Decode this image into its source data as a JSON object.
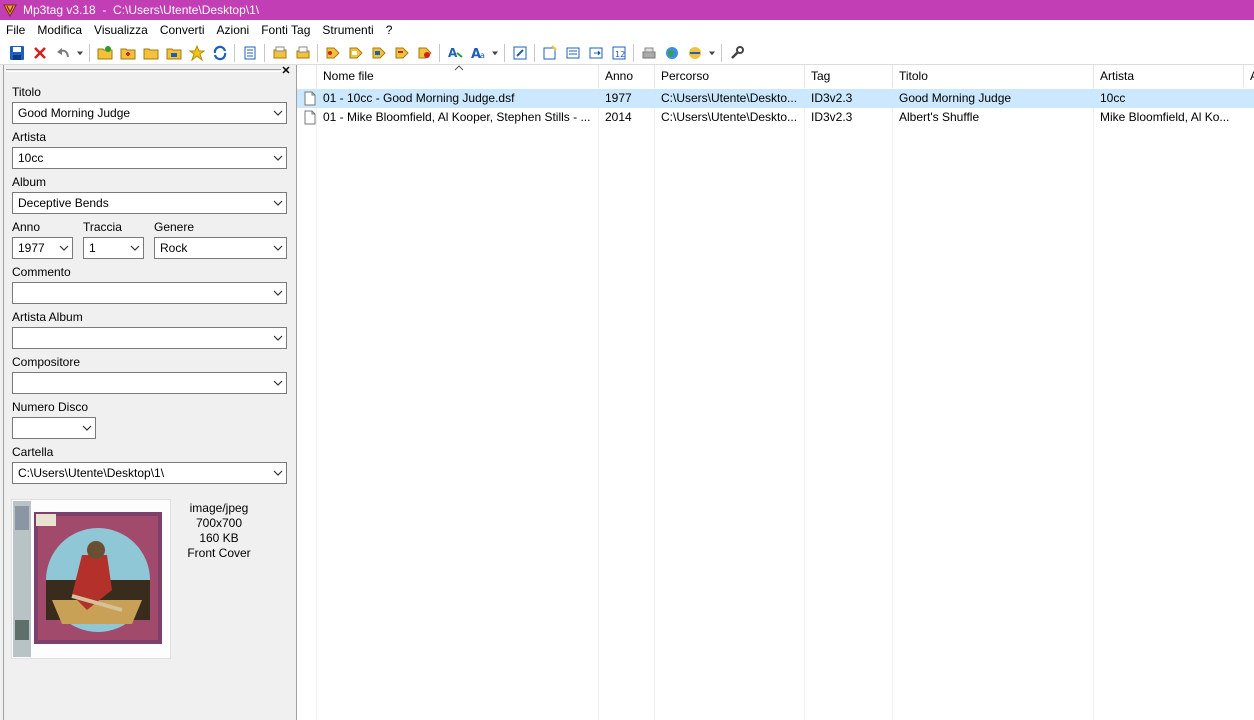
{
  "window": {
    "title": "Mp3tag v3.18  -  C:\\Users\\Utente\\Desktop\\1\\"
  },
  "menu": [
    "File",
    "Modifica",
    "Visualizza",
    "Converti",
    "Azioni",
    "Fonti Tag",
    "Strumenti",
    "?"
  ],
  "toolbar_icons": [
    "save-icon",
    "cancel-icon",
    "undo-icon",
    "dropdown-icon",
    "add-directory-icon",
    "add-files-icon",
    "open-folder-icon",
    "open-subfolder-icon",
    "favorite-icon",
    "refresh-icon",
    "select-all-icon",
    "export-icon",
    "print-icon",
    "tag-from-filename-icon",
    "filename-from-tag-icon",
    "tag-from-tag-icon",
    "text-to-tag-icon",
    "tag-to-text-icon",
    "replace-icon",
    "case-conversion-icon",
    "edit-icon",
    "playlist-icon",
    "list-icon",
    "list-export-icon",
    "numbering-icon",
    "freedb-icon",
    "web-sources-icon",
    "web-dropdown-icon",
    "settings-icon"
  ],
  "tag_panel": {
    "title_label": "Titolo",
    "title_value": "Good Morning Judge",
    "artist_label": "Artista",
    "artist_value": "10cc",
    "album_label": "Album",
    "album_value": "Deceptive Bends",
    "year_label": "Anno",
    "year_value": "1977",
    "track_label": "Traccia",
    "track_value": "1",
    "genre_label": "Genere",
    "genre_value": "Rock",
    "comment_label": "Commento",
    "comment_value": "",
    "album_artist_label": "Artista Album",
    "album_artist_value": "",
    "composer_label": "Compositore",
    "composer_value": "",
    "disc_label": "Numero Disco",
    "disc_value": "",
    "folder_label": "Cartella",
    "folder_value": "C:\\Users\\Utente\\Desktop\\1\\",
    "artwork": {
      "mime": "image/jpeg",
      "dimensions": "700x700",
      "size": "160 KB",
      "type": "Front Cover"
    }
  },
  "file_list": {
    "columns": [
      "Nome file",
      "Anno",
      "Percorso",
      "Tag",
      "Titolo",
      "Artista"
    ],
    "rows": [
      {
        "filename": "01 - 10cc - Good Morning Judge.dsf",
        "year": "1977",
        "path": "C:\\Users\\Utente\\Deskto...",
        "tag": "ID3v2.3",
        "title": "Good Morning Judge",
        "artist": "10cc",
        "selected": true
      },
      {
        "filename": "01 - Mike Bloomfield, Al Kooper, Stephen Stills - ...",
        "year": "2014",
        "path": "C:\\Users\\Utente\\Deskto...",
        "tag": "ID3v2.3",
        "title": "Albert's Shuffle",
        "artist": "Mike Bloomfield, Al Ko...",
        "selected": false
      }
    ]
  },
  "colors": {
    "titlebar": "#c13eb4",
    "selection": "#cce8ff"
  }
}
